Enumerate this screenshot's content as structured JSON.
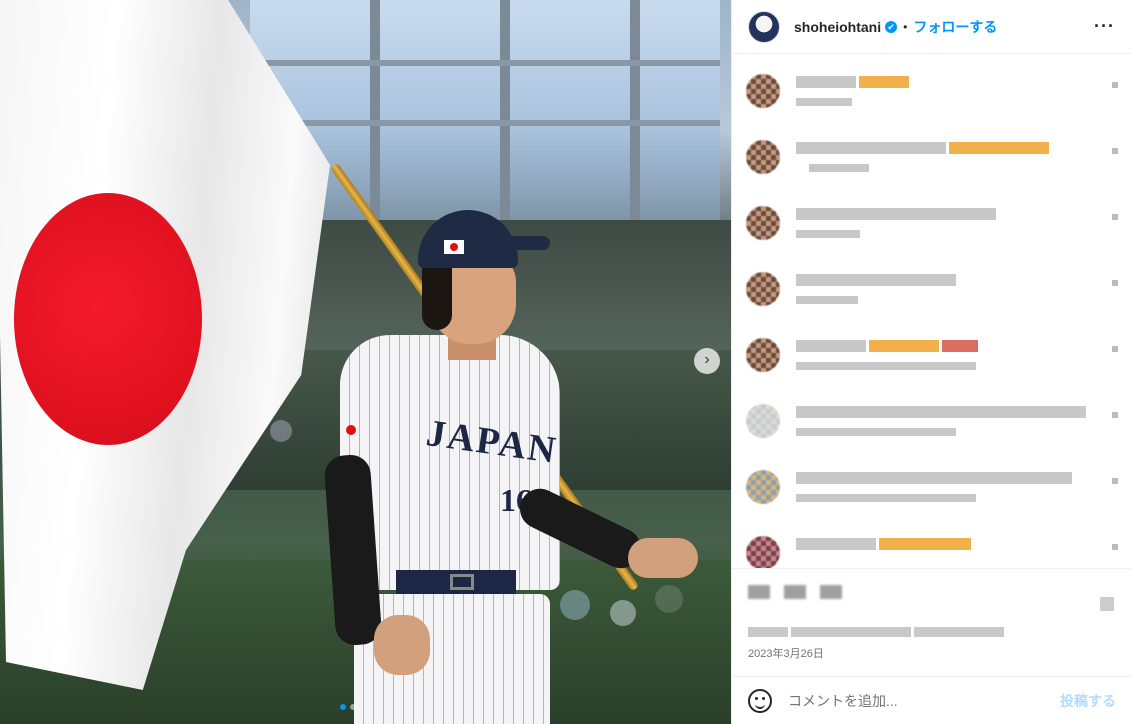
{
  "photo": {
    "jersey_text": "JAPAN",
    "jersey_number": "16",
    "carousel_dots": 2,
    "active_dot": 0
  },
  "header": {
    "username": "shoheiohtani",
    "verified_mark": "✔",
    "separator": "•",
    "follow_label": "フォローする",
    "more_label": "···"
  },
  "post": {
    "date": "2023年3月26日"
  },
  "comment_box": {
    "placeholder": "コメントを追加...",
    "post_label": "投稿する"
  },
  "colors": {
    "accent": "#0095f6",
    "flag_red": "#e0111f",
    "muted_text": "#737373"
  }
}
